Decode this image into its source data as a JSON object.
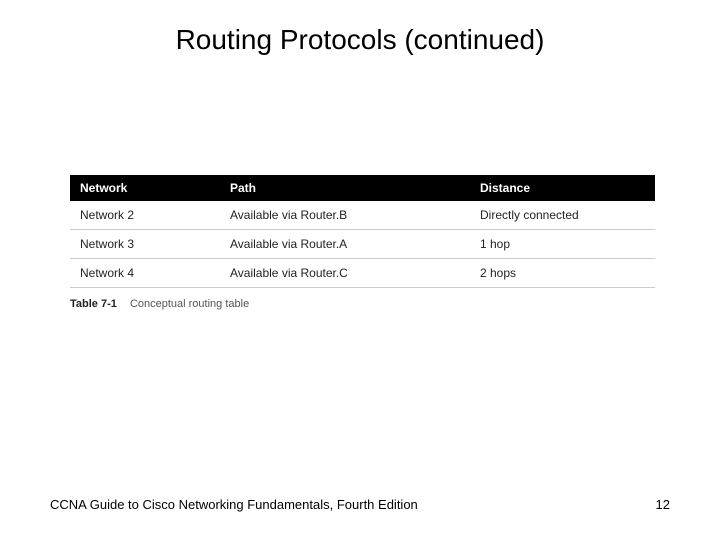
{
  "title": "Routing Protocols (continued)",
  "table": {
    "headers": {
      "network": "Network",
      "path": "Path",
      "distance": "Distance"
    },
    "rows": [
      {
        "network": "Network 2",
        "path": "Available via Router.B",
        "distance": "Directly connected"
      },
      {
        "network": "Network 3",
        "path": "Available via Router.A",
        "distance": "1 hop"
      },
      {
        "network": "Network 4",
        "path": "Available via Router.C",
        "distance": "2 hops"
      }
    ],
    "caption_label": "Table 7-1",
    "caption_text": "Conceptual routing table"
  },
  "footer": {
    "left": "CCNA Guide to Cisco Networking Fundamentals, Fourth Edition",
    "page": "12"
  }
}
